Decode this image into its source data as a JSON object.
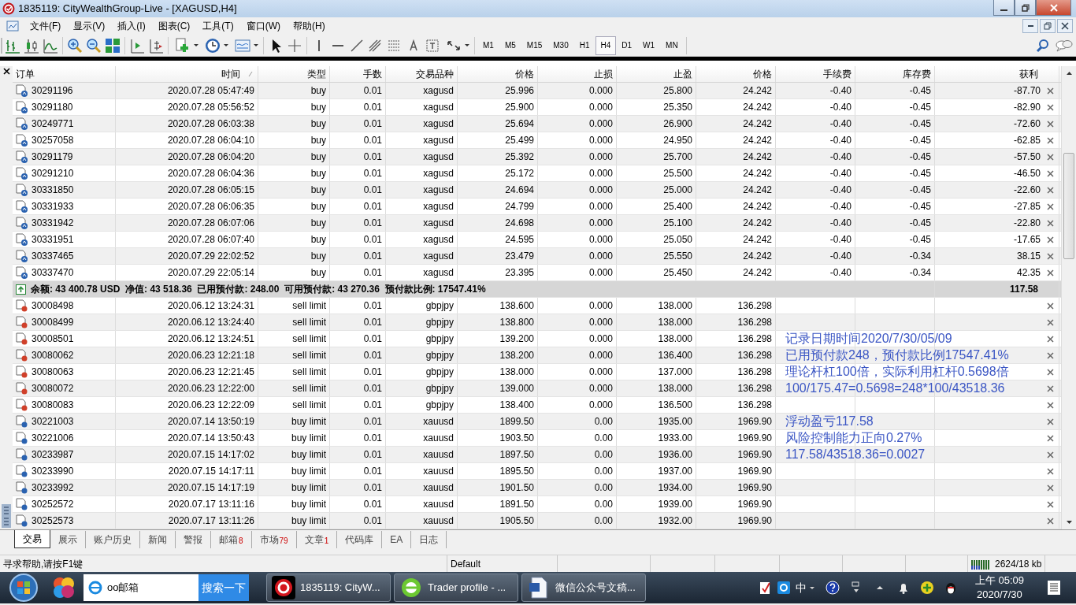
{
  "window": {
    "title": "1835119: CityWealthGroup-Live - [XAGUSD,H4]"
  },
  "menu": [
    "文件(F)",
    "显示(V)",
    "插入(I)",
    "图表(C)",
    "工具(T)",
    "窗口(W)",
    "帮助(H)"
  ],
  "timeframes": [
    {
      "label": "M1",
      "selected": false
    },
    {
      "label": "M5",
      "selected": false
    },
    {
      "label": "M15",
      "selected": false
    },
    {
      "label": "M30",
      "selected": false
    },
    {
      "label": "H1",
      "selected": false
    },
    {
      "label": "H4",
      "selected": true
    },
    {
      "label": "D1",
      "selected": false
    },
    {
      "label": "W1",
      "selected": false
    },
    {
      "label": "MN",
      "selected": false
    }
  ],
  "table": {
    "columns": [
      "订单",
      "时间",
      "类型",
      "手数",
      "交易品种",
      "价格",
      "止损",
      "止盈",
      "价格",
      "手续费",
      "库存费",
      "获利"
    ],
    "positions": [
      {
        "kind": "position",
        "cells": [
          "30291196",
          "2020.07.28 05:47:49",
          "buy",
          "0.01",
          "xagusd",
          "25.996",
          "0.000",
          "25.800",
          "24.242",
          "-0.40",
          "-0.45",
          "-87.70"
        ]
      },
      {
        "kind": "position",
        "cells": [
          "30291180",
          "2020.07.28 05:56:52",
          "buy",
          "0.01",
          "xagusd",
          "25.900",
          "0.000",
          "25.350",
          "24.242",
          "-0.40",
          "-0.45",
          "-82.90"
        ]
      },
      {
        "kind": "position",
        "cells": [
          "30249771",
          "2020.07.28 06:03:38",
          "buy",
          "0.01",
          "xagusd",
          "25.694",
          "0.000",
          "26.900",
          "24.242",
          "-0.40",
          "-0.45",
          "-72.60"
        ]
      },
      {
        "kind": "position",
        "cells": [
          "30257058",
          "2020.07.28 06:04:10",
          "buy",
          "0.01",
          "xagusd",
          "25.499",
          "0.000",
          "24.950",
          "24.242",
          "-0.40",
          "-0.45",
          "-62.85"
        ]
      },
      {
        "kind": "position",
        "cells": [
          "30291179",
          "2020.07.28 06:04:20",
          "buy",
          "0.01",
          "xagusd",
          "25.392",
          "0.000",
          "25.700",
          "24.242",
          "-0.40",
          "-0.45",
          "-57.50"
        ]
      },
      {
        "kind": "position",
        "cells": [
          "30291210",
          "2020.07.28 06:04:36",
          "buy",
          "0.01",
          "xagusd",
          "25.172",
          "0.000",
          "25.500",
          "24.242",
          "-0.40",
          "-0.45",
          "-46.50"
        ]
      },
      {
        "kind": "position",
        "cells": [
          "30331850",
          "2020.07.28 06:05:15",
          "buy",
          "0.01",
          "xagusd",
          "24.694",
          "0.000",
          "25.000",
          "24.242",
          "-0.40",
          "-0.45",
          "-22.60"
        ]
      },
      {
        "kind": "position",
        "cells": [
          "30331933",
          "2020.07.28 06:06:35",
          "buy",
          "0.01",
          "xagusd",
          "24.799",
          "0.000",
          "25.400",
          "24.242",
          "-0.40",
          "-0.45",
          "-27.85"
        ]
      },
      {
        "kind": "position",
        "cells": [
          "30331942",
          "2020.07.28 06:07:06",
          "buy",
          "0.01",
          "xagusd",
          "24.698",
          "0.000",
          "25.100",
          "24.242",
          "-0.40",
          "-0.45",
          "-22.80"
        ]
      },
      {
        "kind": "position",
        "cells": [
          "30331951",
          "2020.07.28 06:07:40",
          "buy",
          "0.01",
          "xagusd",
          "24.595",
          "0.000",
          "25.050",
          "24.242",
          "-0.40",
          "-0.45",
          "-17.65"
        ]
      },
      {
        "kind": "position",
        "cells": [
          "30337465",
          "2020.07.29 22:02:52",
          "buy",
          "0.01",
          "xagusd",
          "23.479",
          "0.000",
          "25.550",
          "24.242",
          "-0.40",
          "-0.34",
          "38.15"
        ]
      },
      {
        "kind": "position",
        "cells": [
          "30337470",
          "2020.07.29 22:05:14",
          "buy",
          "0.01",
          "xagusd",
          "23.395",
          "0.000",
          "25.450",
          "24.242",
          "-0.40",
          "-0.34",
          "42.35"
        ]
      }
    ],
    "summary": {
      "text": "余额: 43 400.78 USD  净值: 43 518.36  已用预付款: 248.00  可用预付款: 43 270.36  预付款比例: 17547.41%",
      "profit": "117.58"
    },
    "pending_orders": [
      {
        "kind": "sell_order",
        "cells": [
          "30008498",
          "2020.06.12 13:24:31",
          "sell limit",
          "0.01",
          "gbpjpy",
          "138.600",
          "0.000",
          "138.000",
          "136.298"
        ]
      },
      {
        "kind": "sell_order",
        "cells": [
          "30008499",
          "2020.06.12 13:24:40",
          "sell limit",
          "0.01",
          "gbpjpy",
          "138.800",
          "0.000",
          "138.000",
          "136.298"
        ]
      },
      {
        "kind": "sell_order",
        "cells": [
          "30008501",
          "2020.06.12 13:24:51",
          "sell limit",
          "0.01",
          "gbpjpy",
          "139.200",
          "0.000",
          "138.000",
          "136.298"
        ]
      },
      {
        "kind": "sell_order",
        "cells": [
          "30080062",
          "2020.06.23 12:21:18",
          "sell limit",
          "0.01",
          "gbpjpy",
          "138.200",
          "0.000",
          "136.400",
          "136.298"
        ]
      },
      {
        "kind": "sell_order",
        "cells": [
          "30080063",
          "2020.06.23 12:21:45",
          "sell limit",
          "0.01",
          "gbpjpy",
          "138.000",
          "0.000",
          "137.000",
          "136.298"
        ]
      },
      {
        "kind": "sell_order",
        "cells": [
          "30080072",
          "2020.06.23 12:22:00",
          "sell limit",
          "0.01",
          "gbpjpy",
          "139.000",
          "0.000",
          "138.000",
          "136.298"
        ]
      },
      {
        "kind": "sell_order",
        "cells": [
          "30080083",
          "2020.06.23 12:22:09",
          "sell limit",
          "0.01",
          "gbpjpy",
          "138.400",
          "0.000",
          "136.500",
          "136.298"
        ]
      },
      {
        "kind": "buy_order",
        "cells": [
          "30221003",
          "2020.07.14 13:50:19",
          "buy limit",
          "0.01",
          "xauusd",
          "1899.50",
          "0.00",
          "1935.00",
          "1969.90"
        ]
      },
      {
        "kind": "buy_order",
        "cells": [
          "30221006",
          "2020.07.14 13:50:43",
          "buy limit",
          "0.01",
          "xauusd",
          "1903.50",
          "0.00",
          "1933.00",
          "1969.90"
        ]
      },
      {
        "kind": "buy_order",
        "cells": [
          "30233987",
          "2020.07.15 14:17:02",
          "buy limit",
          "0.01",
          "xauusd",
          "1897.50",
          "0.00",
          "1936.00",
          "1969.90"
        ]
      },
      {
        "kind": "buy_order",
        "cells": [
          "30233990",
          "2020.07.15 14:17:11",
          "buy limit",
          "0.01",
          "xauusd",
          "1895.50",
          "0.00",
          "1937.00",
          "1969.90"
        ]
      },
      {
        "kind": "buy_order",
        "cells": [
          "30233992",
          "2020.07.15 14:17:19",
          "buy limit",
          "0.01",
          "xauusd",
          "1901.50",
          "0.00",
          "1934.00",
          "1969.90"
        ]
      },
      {
        "kind": "buy_order",
        "cells": [
          "30252572",
          "2020.07.17 13:11:16",
          "buy limit",
          "0.01",
          "xauusd",
          "1891.50",
          "0.00",
          "1939.00",
          "1969.90"
        ]
      },
      {
        "kind": "buy_order",
        "cells": [
          "30252573",
          "2020.07.17 13:11:26",
          "buy limit",
          "0.01",
          "xauusd",
          "1905.50",
          "0.00",
          "1932.00",
          "1969.90"
        ]
      }
    ]
  },
  "note_blocks": [
    {
      "lines": [
        "记录日期时间2020/7/30/05/09",
        "已用预付款248，预付款比例17547.41%",
        "理论杆杠100倍，实际利用杠杆0.5698倍",
        "100/175.47=0.5698=248*100/43518.36"
      ]
    },
    {
      "lines": [
        "浮动盈亏117.58",
        "风险控制能力正向0.27%",
        "117.58/43518.36=0.0027"
      ]
    }
  ],
  "tabs": [
    {
      "label": "交易",
      "selected": true
    },
    {
      "label": "展示",
      "selected": false
    },
    {
      "label": "账户历史",
      "selected": false
    },
    {
      "label": "新闻",
      "selected": false
    },
    {
      "label": "警报",
      "selected": false
    },
    {
      "label": "邮箱",
      "count": "8",
      "selected": false
    },
    {
      "label": "市场",
      "count": "79",
      "selected": false
    },
    {
      "label": "文章",
      "count": "1",
      "selected": false
    },
    {
      "label": "代码库",
      "selected": false
    },
    {
      "label": "EA",
      "selected": false
    },
    {
      "label": "日志",
      "selected": false
    }
  ],
  "status_bar": {
    "help": "寻求帮助,请按F1键",
    "profile": "Default",
    "traffic": "2624/18 kb"
  },
  "taskbar": {
    "search_value": "oo邮箱",
    "search_button": "搜索一下",
    "items": [
      {
        "label": "1835119: CityW...",
        "kind": "mt4"
      },
      {
        "label": "Trader profile - ...",
        "kind": "browser"
      },
      {
        "label": "微信公众号文稿...",
        "kind": "word"
      }
    ],
    "ime": "中",
    "time": "上午 05:09",
    "date": "2020/7/30"
  }
}
